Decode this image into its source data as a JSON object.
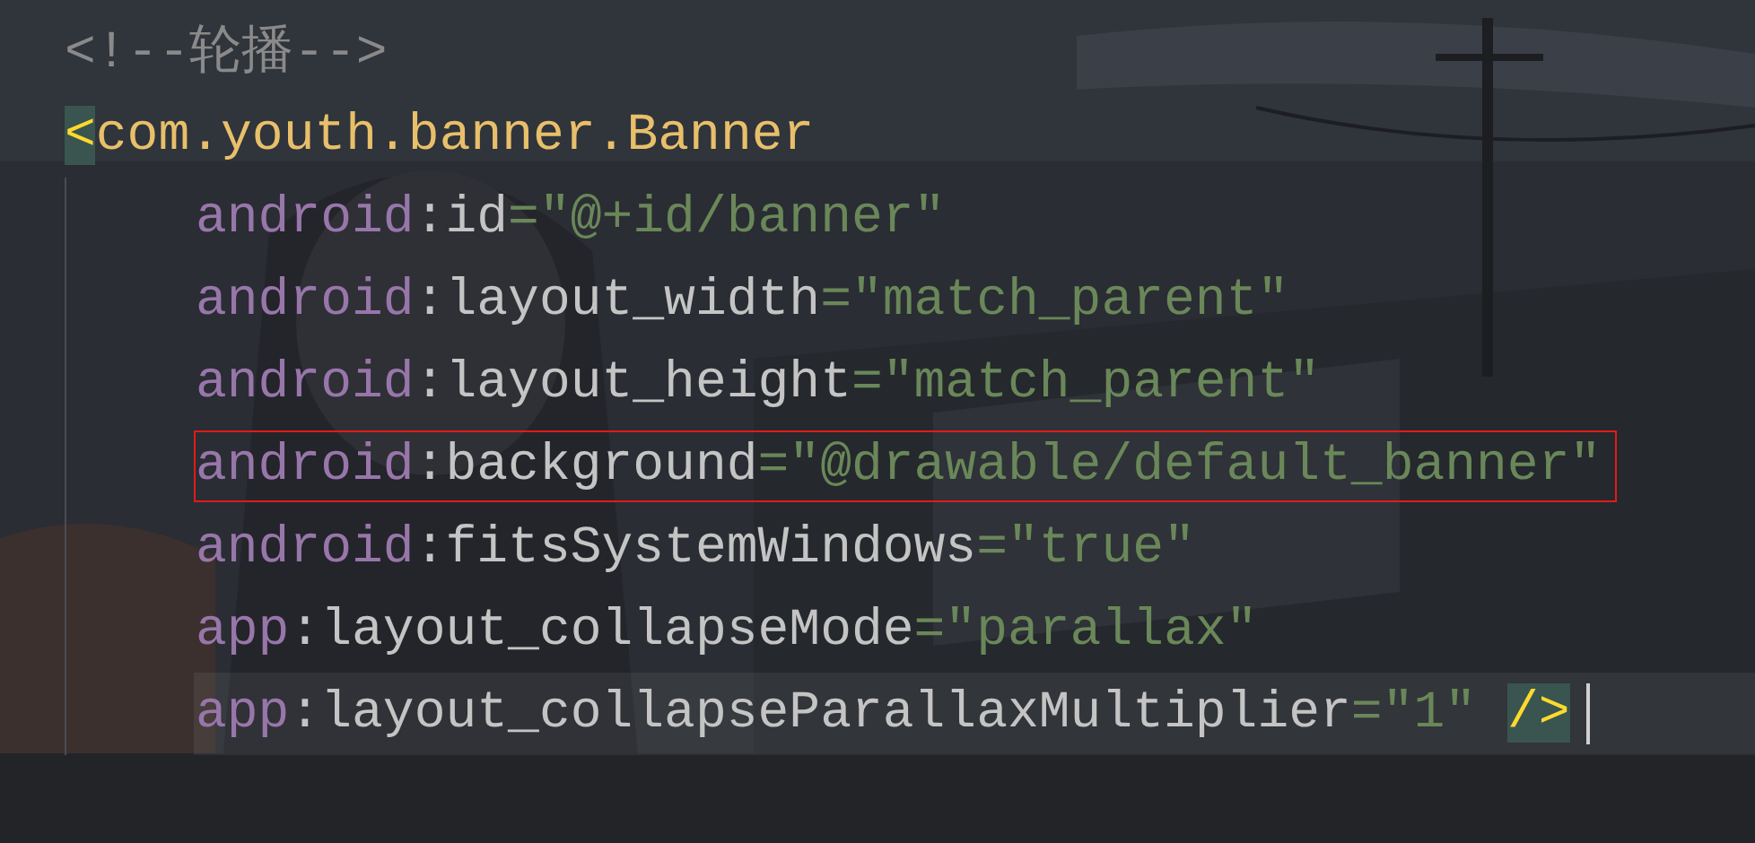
{
  "editor": {
    "lines": [
      {
        "current": false,
        "boxed": false,
        "tokens": [
          {
            "kind": "comment",
            "text": "<!--轮播-->"
          }
        ]
      },
      {
        "current": false,
        "boxed": false,
        "tokens": [
          {
            "kind": "bracket",
            "text": "<",
            "matched": true
          },
          {
            "kind": "tag",
            "text": "com.youth.banner.Banner"
          }
        ],
        "children": [
          {
            "current": false,
            "boxed": false,
            "tokens": [
              {
                "kind": "namespace",
                "text": "android"
              },
              {
                "kind": "attr",
                "text": ":id"
              },
              {
                "kind": "string",
                "text": "=\"@+id/banner\""
              }
            ]
          },
          {
            "current": false,
            "boxed": false,
            "tokens": [
              {
                "kind": "namespace",
                "text": "android"
              },
              {
                "kind": "attr",
                "text": ":layout_width"
              },
              {
                "kind": "string",
                "text": "=\"match_parent\""
              }
            ]
          },
          {
            "current": false,
            "boxed": false,
            "tokens": [
              {
                "kind": "namespace",
                "text": "android"
              },
              {
                "kind": "attr",
                "text": ":layout_height"
              },
              {
                "kind": "string",
                "text": "=\"match_parent\""
              }
            ]
          },
          {
            "current": false,
            "boxed": true,
            "tokens": [
              {
                "kind": "namespace",
                "text": "android"
              },
              {
                "kind": "attr",
                "text": ":background"
              },
              {
                "kind": "string",
                "text": "=\"@drawable/default_banner\""
              }
            ]
          },
          {
            "current": false,
            "boxed": false,
            "tokens": [
              {
                "kind": "namespace",
                "text": "android"
              },
              {
                "kind": "attr",
                "text": ":fitsSystemWindows"
              },
              {
                "kind": "string",
                "text": "=\"true\""
              }
            ]
          },
          {
            "current": false,
            "boxed": false,
            "tokens": [
              {
                "kind": "namespace",
                "text": "app"
              },
              {
                "kind": "attr",
                "text": ":layout_collapseMode"
              },
              {
                "kind": "string",
                "text": "=\"parallax\""
              }
            ]
          },
          {
            "current": true,
            "boxed": false,
            "tokens": [
              {
                "kind": "namespace",
                "text": "app"
              },
              {
                "kind": "attr",
                "text": ":layout_collapseParallaxMultiplier"
              },
              {
                "kind": "string",
                "text": "=\"1\" "
              },
              {
                "kind": "bracket",
                "text": "/>",
                "matched": true
              }
            ]
          }
        ]
      }
    ]
  }
}
